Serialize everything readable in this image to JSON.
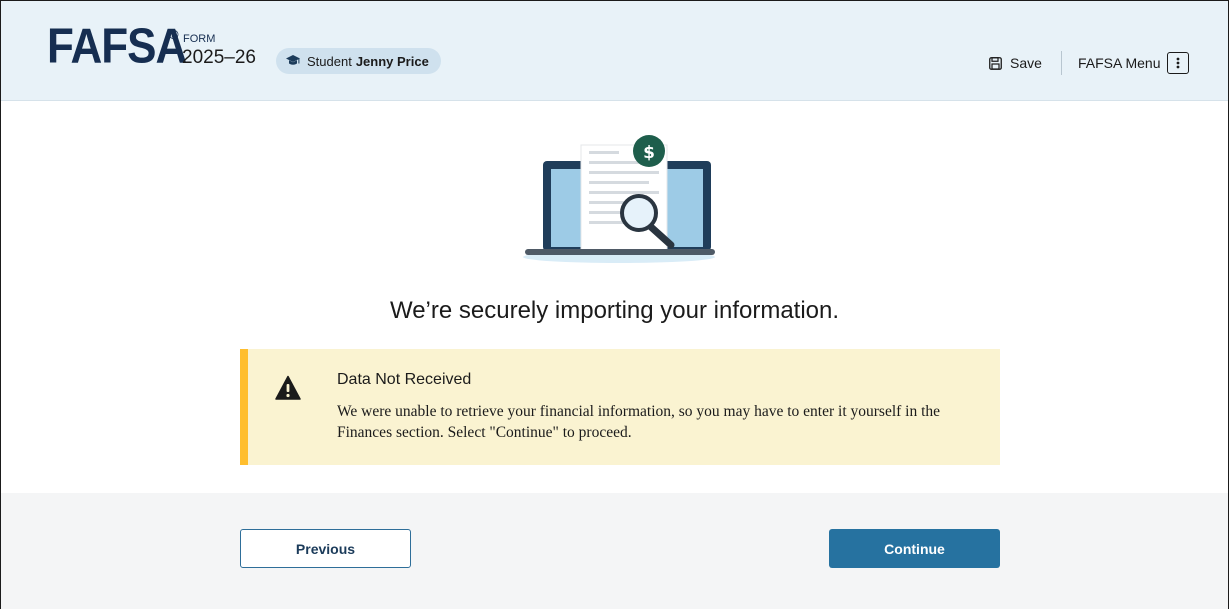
{
  "header": {
    "logo": "FAFSA",
    "registered": "®",
    "form_label": "FORM",
    "form_year": "2025–26",
    "student_role": "Student",
    "student_name": "Jenny Price",
    "save_label": "Save",
    "menu_label": "FAFSA Menu"
  },
  "main": {
    "heading": "We’re securely importing your information."
  },
  "alert": {
    "title": "Data Not Received",
    "body": "We were unable to retrieve your financial information, so you may have to enter it yourself in the Finances section. Select \"Continue\" to proceed."
  },
  "footer": {
    "previous_label": "Previous",
    "continue_label": "Continue"
  },
  "icons": {
    "graduation": "graduation-cap-icon",
    "save": "save-icon",
    "menu": "kebab-menu-icon",
    "warning": "warning-icon",
    "dollar": "dollar-badge-icon",
    "magnifier": "magnifying-glass-icon"
  },
  "colors": {
    "header_bg": "#e8f2f8",
    "brand_navy": "#162e51",
    "alert_bg": "#faf3d1",
    "alert_accent": "#ffbe2e",
    "primary_button": "#2672a0"
  }
}
